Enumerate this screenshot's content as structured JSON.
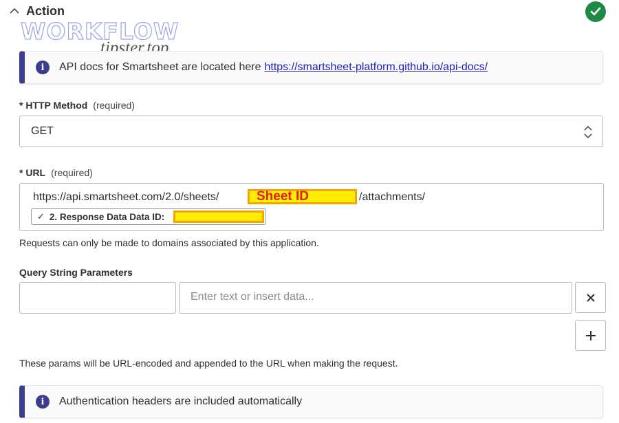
{
  "header": {
    "title": "Action",
    "collapse_icon": "chevron-up-icon",
    "status_icon": "check-circle-icon",
    "status_color": "#1e8a47"
  },
  "watermark": {
    "line1": "WORKFLOW",
    "line2": "tipster.top"
  },
  "info_api": {
    "icon": "info-icon",
    "text": "API docs for Smartsheet are located here",
    "link": "https://smartsheet-platform.github.io/api-docs/",
    "accent": "#3d3d8e"
  },
  "http_method": {
    "label": "* HTTP Method",
    "required": "(required)",
    "value": "GET"
  },
  "url": {
    "label": "* URL",
    "required": "(required)",
    "prefix": "https://api.smartsheet.com/2.0/sheets/",
    "redaction_label": "Sheet ID",
    "suffix": "/attachments/",
    "token_label": "2. Response Data Data ID:",
    "token_check": "✓",
    "help": "Requests can only be made to domains associated by this application."
  },
  "query": {
    "label": "Query String Parameters",
    "key_value": "",
    "value_placeholder": "Enter text or insert data...",
    "remove_icon": "close-icon",
    "add_icon": "plus-icon",
    "help": "These params will be URL-encoded and appended to the URL when making the request."
  },
  "info_auth": {
    "icon": "info-icon",
    "text": "Authentication headers are included automatically"
  }
}
